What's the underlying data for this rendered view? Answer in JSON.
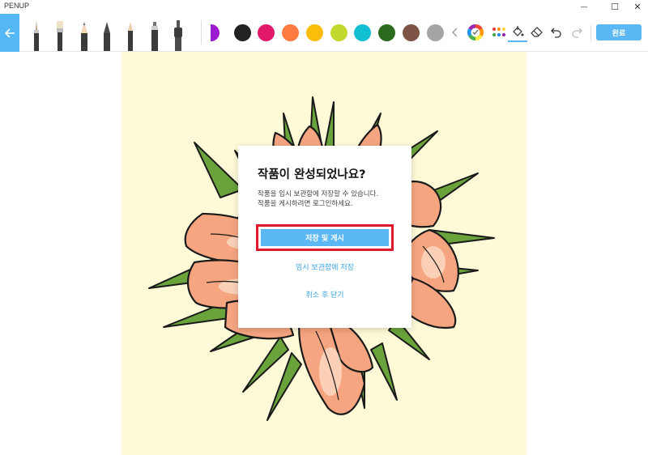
{
  "window": {
    "title": "PENUP",
    "minimize_glyph": "—",
    "maximize_glyph": "☐",
    "close_glyph": "✕"
  },
  "toolbar": {
    "back_icon": "arrow-left-icon",
    "pens": [
      "brush",
      "flat-brush",
      "pencil",
      "fountain-pen",
      "marker",
      "spray",
      "airbrush"
    ],
    "colors": [
      "#9b19cf",
      "#222222",
      "#e2196b",
      "#fd7a41",
      "#fcbc0a",
      "#c2d82e",
      "#12bed1",
      "#2c6a1e",
      "#7e5446",
      "#a4a4a4"
    ],
    "icons": [
      "chevron-left-icon",
      "color-wheel-icon",
      "palette-dots-icon",
      "paint-bucket-icon",
      "eraser-icon",
      "undo-icon",
      "redo-icon"
    ],
    "done_label": "완료"
  },
  "dialog": {
    "title": "작품이 완성되었나요?",
    "message_line1": "작품을 임시 보관함에 저장할 수 있습니다.",
    "message_line2": "작품을 게시하려면 로그인하세요.",
    "primary_label": "저장 및 게시",
    "secondary_label": "임시 보관함에 저장",
    "cancel_label": "취소 후 닫기"
  }
}
